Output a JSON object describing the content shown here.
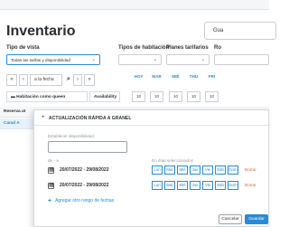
{
  "page": {
    "title": "Inventario",
    "top_button_label": "Gua"
  },
  "filters": {
    "view_type_label": "Tipo de vista",
    "view_type_value": "Todas las tarifas y disponibilidad",
    "room_types_label": "Tipos de habitación",
    "rate_plans_label": "Planes tarifarios",
    "extra_label": "Ro"
  },
  "pager": {
    "first": "«",
    "prev": "‹",
    "date_label": "a la fecha",
    "next": "›",
    "last": "»",
    "calendar_icon": "calendar-icon"
  },
  "days": [
    {
      "name": "HOY",
      "date": "—"
    },
    {
      "name": "MAR",
      "date": "—"
    },
    {
      "name": "MIÉ",
      "date": "—"
    },
    {
      "name": "THU",
      "date": "—"
    },
    {
      "name": "FRI",
      "date": "—"
    }
  ],
  "grid": {
    "room_header": "Habitación como queen",
    "availability_header": "Availability",
    "availability_values": [
      "10",
      "10",
      "10",
      "10",
      "10"
    ],
    "row_reserva": "Reserva at",
    "row_canal": "Canal A"
  },
  "modal": {
    "title": "ACTUALIZACIÓN RÁPIDA A GRANEL",
    "set_availability_label": "Establecer disponibilidad",
    "availability_value": "",
    "from_label": "de - a",
    "selected_days_label": "En días seleccionados",
    "ranges": [
      {
        "checked": "☑",
        "range": "20/07/2022 - 29/08/2022"
      },
      {
        "checked": "☑",
        "range": "20/07/2022 - 29/08/2022"
      }
    ],
    "weekdays": [
      "Lun",
      "Mar",
      "Mié",
      "Jue",
      "Vie",
      "Sáb",
      "Dom"
    ],
    "delete_label": "Borrar",
    "add_range_label": "Agregar otro rango de fechas",
    "cancel_label": "Cancelar",
    "save_label": "Guardar"
  },
  "colors": {
    "accent": "#2a8ad6",
    "delete": "#e0663f"
  }
}
